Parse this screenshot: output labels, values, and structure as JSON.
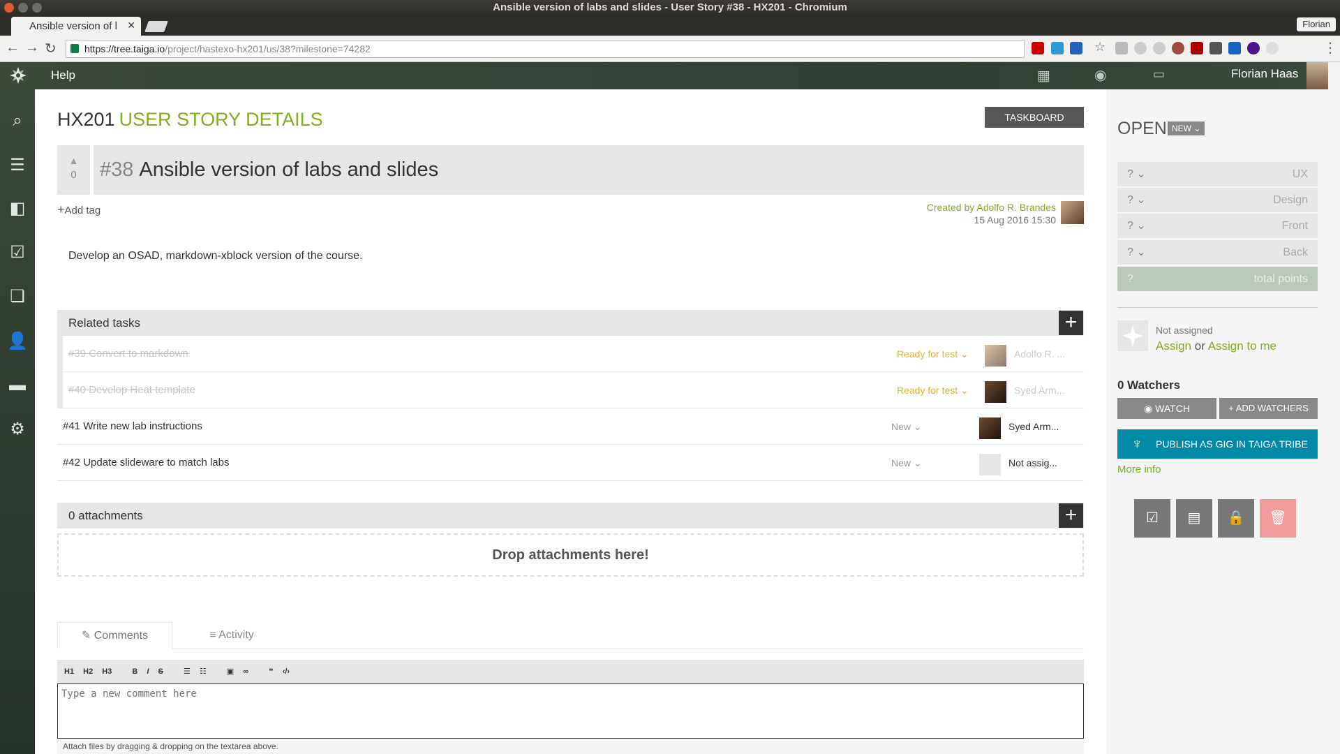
{
  "browser": {
    "window_title": "Ansible version of labs and slides - User Story #38 - HX201 - Chromium",
    "tab_title": "Ansible version of l",
    "profile": "Florian",
    "url_host": "https://tree.taiga.io",
    "url_path": "/project/hastexo-hx201/us/38?milestone=74282"
  },
  "navbar": {
    "help": "Help",
    "user_name": "Florian Haas"
  },
  "header": {
    "project": "HX201",
    "section": "USER STORY DETAILS",
    "taskboard": "TASKBOARD"
  },
  "story": {
    "votes": "0",
    "ref": "#38",
    "title": "Ansible version of labs and slides",
    "add_tag": "Add tag",
    "created_by": "Created by Adolfo R. Brandes",
    "created_date": "15 Aug 2016 15:30",
    "description": "Develop an OSAD, markdown-xblock version of the course."
  },
  "related": {
    "title": "Related tasks",
    "tasks": [
      {
        "title": "#39 Convert to markdown",
        "status": "Ready for test",
        "assignee": "Adolfo R. ..."
      },
      {
        "title": "#40 Develop Heat template",
        "status": "Ready for test",
        "assignee": "Syed Arm..."
      },
      {
        "title": "#41 Write new lab instructions",
        "status": "New",
        "assignee": "Syed Arm..."
      },
      {
        "title": "#42 Update slideware to match labs",
        "status": "New",
        "assignee": "Not assig..."
      }
    ]
  },
  "attachments": {
    "title": "0 attachments",
    "drop": "Drop attachments here!"
  },
  "comments": {
    "tab_comments": "Comments",
    "tab_activity": "Activity",
    "toolbar": [
      "H1",
      "H2",
      "H3",
      "B",
      "I",
      "S"
    ],
    "placeholder": "Type a new comment here",
    "hint": "Attach files by dragging & dropping on the textarea above."
  },
  "panel": {
    "status": "OPEN",
    "status_badge": "NEW",
    "points": [
      {
        "value": "?",
        "label": "UX"
      },
      {
        "value": "?",
        "label": "Design"
      },
      {
        "value": "?",
        "label": "Front"
      },
      {
        "value": "?",
        "label": "Back"
      }
    ],
    "total": {
      "value": "?",
      "label": "total points"
    },
    "not_assigned": "Not assigned",
    "assign": "Assign",
    "or": "or",
    "assign_to_me": "Assign to me",
    "watchers": "0 Watchers",
    "watch": "WATCH",
    "add_watchers": "+ ADD WATCHERS",
    "publish": "PUBLISH AS GIG IN TAIGA TRIBE",
    "more_info": "More info"
  },
  "colors": {
    "accent": "#83ae21",
    "ready_for_test": "#e8b41c",
    "publish": "#008aa8",
    "delete": "#f19b9b"
  }
}
